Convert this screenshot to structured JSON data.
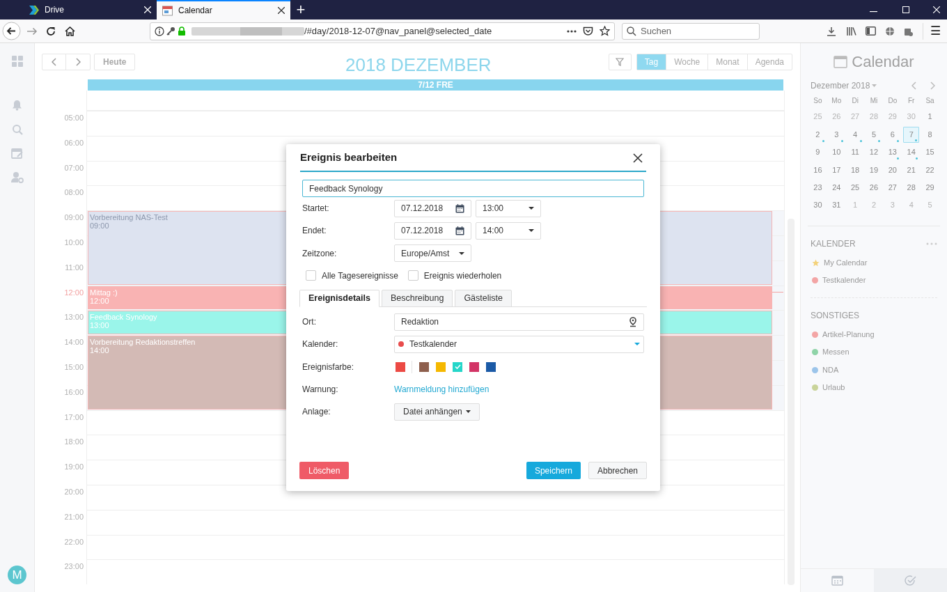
{
  "browser": {
    "tabs": [
      {
        "title": "Drive",
        "kind": "drive",
        "selected": false
      },
      {
        "title": "Calendar",
        "kind": "calendar",
        "selected": true
      }
    ],
    "new_tab": "+",
    "url": "/#day/2018-12-07@nav_panel@selected_date",
    "search": {
      "placeholder": "Suchen"
    },
    "menu": "☰"
  },
  "toolbar": {
    "today": "Heute",
    "title": "2018 DEZEMBER",
    "views": [
      {
        "label": "Tag",
        "selected": true
      },
      {
        "label": "Woche",
        "selected": false
      },
      {
        "label": "Monat",
        "selected": false
      },
      {
        "label": "Agenda",
        "selected": false
      }
    ]
  },
  "day_header": "7/12 FRE",
  "hours": [
    {
      "label": "05:00",
      "current": false,
      "busy": false
    },
    {
      "label": "06:00",
      "current": false,
      "busy": false
    },
    {
      "label": "07:00",
      "current": false,
      "busy": false
    },
    {
      "label": "08:00",
      "current": false,
      "busy": false
    },
    {
      "label": "09:00",
      "current": false,
      "busy": true
    },
    {
      "label": "10:00",
      "current": false,
      "busy": true
    },
    {
      "label": "11:00",
      "current": false,
      "busy": true
    },
    {
      "label": "12:00",
      "current": true,
      "busy": true
    },
    {
      "label": "13:00",
      "current": false,
      "busy": true
    },
    {
      "label": "14:00",
      "current": false,
      "busy": true
    },
    {
      "label": "15:00",
      "current": false,
      "busy": true
    },
    {
      "label": "16:00",
      "current": false,
      "busy": true
    },
    {
      "label": "17:00",
      "current": false
    },
    {
      "label": "18:00",
      "current": false
    },
    {
      "label": "19:00",
      "current": false
    },
    {
      "label": "20:00",
      "current": false
    },
    {
      "label": "21:00",
      "current": false
    },
    {
      "label": "22:00",
      "current": false
    },
    {
      "label": "23:00",
      "current": false
    }
  ],
  "events": [
    {
      "title": "Vorbereitung NAS-Test",
      "time": "09:00",
      "color": "#dde3f0"
    },
    {
      "title": "Mittag :)",
      "time": "12:00",
      "color": "#f9b3b3"
    },
    {
      "title": "Feedback Synology",
      "time": "13:00",
      "color": "#9af5ea"
    },
    {
      "title": "Vorbereitung Redaktionstreffen",
      "time": "14:00",
      "color": "#d3bab5"
    }
  ],
  "avatar": "M",
  "sidebar": {
    "title": "Calendar",
    "month": "Dezember 2018",
    "weekdays": [
      "So",
      "Mo",
      "Di",
      "Mi",
      "Do",
      "Fr",
      "Sa"
    ],
    "weeks": [
      [
        {
          "day": "25",
          "muted": true,
          "selected": false,
          "has_events": false
        },
        {
          "day": "26",
          "muted": true,
          "selected": false,
          "has_events": false
        },
        {
          "day": "27",
          "muted": true,
          "selected": false,
          "has_events": false
        },
        {
          "day": "28",
          "muted": true,
          "selected": false,
          "has_events": false
        },
        {
          "day": "29",
          "muted": true,
          "selected": false,
          "has_events": false
        },
        {
          "day": "30",
          "muted": true,
          "selected": false,
          "has_events": false
        },
        {
          "day": "1",
          "muted": false,
          "selected": false,
          "has_events": false
        }
      ],
      [
        {
          "day": "2",
          "muted": false,
          "selected": false,
          "has_events": true
        },
        {
          "day": "3",
          "muted": false,
          "selected": false,
          "has_events": true
        },
        {
          "day": "4",
          "muted": false,
          "selected": false,
          "has_events": true
        },
        {
          "day": "5",
          "muted": false,
          "selected": false,
          "has_events": true
        },
        {
          "day": "6",
          "muted": false,
          "selected": false,
          "has_events": true
        },
        {
          "day": "7",
          "muted": false,
          "selected": true,
          "has_events": true
        },
        {
          "day": "8",
          "muted": false,
          "selected": false,
          "has_events": false
        }
      ],
      [
        {
          "day": "9",
          "muted": false,
          "selected": false,
          "has_events": false
        },
        {
          "day": "10",
          "muted": false,
          "selected": false,
          "has_events": false
        },
        {
          "day": "11",
          "muted": false,
          "selected": false,
          "has_events": false
        },
        {
          "day": "12",
          "muted": false,
          "selected": false,
          "has_events": false
        },
        {
          "day": "13",
          "muted": false,
          "selected": false,
          "has_events": true
        },
        {
          "day": "14",
          "muted": false,
          "selected": false,
          "has_events": true
        },
        {
          "day": "15",
          "muted": false,
          "selected": false,
          "has_events": false
        }
      ],
      [
        {
          "day": "16",
          "muted": false,
          "selected": false,
          "has_events": false
        },
        {
          "day": "17",
          "muted": false,
          "selected": false,
          "has_events": false
        },
        {
          "day": "18",
          "muted": false,
          "selected": false,
          "has_events": false
        },
        {
          "day": "19",
          "muted": false,
          "selected": false,
          "has_events": false
        },
        {
          "day": "20",
          "muted": false,
          "selected": false,
          "has_events": false
        },
        {
          "day": "21",
          "muted": false,
          "selected": false,
          "has_events": false
        },
        {
          "day": "22",
          "muted": false,
          "selected": false,
          "has_events": false
        }
      ],
      [
        {
          "day": "23",
          "muted": false,
          "selected": false,
          "has_events": false
        },
        {
          "day": "24",
          "muted": false,
          "selected": false,
          "has_events": false
        },
        {
          "day": "25",
          "muted": false,
          "selected": false,
          "has_events": false
        },
        {
          "day": "26",
          "muted": false,
          "selected": false,
          "has_events": false
        },
        {
          "day": "27",
          "muted": false,
          "selected": false,
          "has_events": false
        },
        {
          "day": "28",
          "muted": false,
          "selected": false,
          "has_events": false
        },
        {
          "day": "29",
          "muted": false,
          "selected": false,
          "has_events": false
        }
      ],
      [
        {
          "day": "30",
          "muted": false,
          "selected": false,
          "has_events": false
        },
        {
          "day": "31",
          "muted": false,
          "selected": false,
          "has_events": false
        },
        {
          "day": "1",
          "muted": true,
          "selected": false,
          "has_events": false
        },
        {
          "day": "2",
          "muted": true,
          "selected": false,
          "has_events": false
        },
        {
          "day": "3",
          "muted": true,
          "selected": false,
          "has_events": false
        },
        {
          "day": "4",
          "muted": true,
          "selected": false,
          "has_events": false
        },
        {
          "day": "5",
          "muted": true,
          "selected": false,
          "has_events": false
        }
      ]
    ],
    "sections": [
      {
        "heading": "KALENDER",
        "items": [
          {
            "label": "My Calendar",
            "kind": "star",
            "color": "#f3d27a"
          },
          {
            "label": "Testkalender",
            "kind": "dot",
            "color": "#f3a5a5"
          }
        ]
      },
      {
        "heading": "SONSTIGES",
        "items": [
          {
            "label": "Artikel-Planung",
            "kind": "dot",
            "color": "#f3a5a5"
          },
          {
            "label": "Messen",
            "kind": "dot",
            "color": "#8fd4a8"
          },
          {
            "label": "NDA",
            "kind": "dot",
            "color": "#9cc5ea"
          },
          {
            "label": "Urlaub",
            "kind": "dot",
            "color": "#c9d49a"
          }
        ]
      }
    ]
  },
  "dialog": {
    "title": "Ereignis bearbeiten",
    "name": "Feedback Synology",
    "start": {
      "label": "Startet:",
      "date": "07.12.2018",
      "time": "13:00"
    },
    "end": {
      "label": "Endet:",
      "date": "07.12.2018",
      "time": "14:00"
    },
    "timezone": {
      "label": "Zeitzone:",
      "value": "Europe/Amst"
    },
    "checkboxes": [
      {
        "label": "Alle Tagesereignisse",
        "checked": false
      },
      {
        "label": "Ereignis wiederholen",
        "checked": false
      }
    ],
    "tabs": [
      {
        "label": "Ereignisdetails",
        "selected": true
      },
      {
        "label": "Beschreibung",
        "selected": false
      },
      {
        "label": "Gästeliste",
        "selected": false
      }
    ],
    "location": {
      "label": "Ort:",
      "value": "Redaktion"
    },
    "calendar": {
      "label": "Kalender:",
      "value": "Testkalender",
      "color": "#e84c4c"
    },
    "event_color": {
      "label": "Ereignisfarbe:",
      "swatches": [
        {
          "color": "#ec4a44",
          "kind": "default",
          "selected": false
        },
        {
          "color": "#8e5f4d",
          "kind": "custom",
          "selected": false
        },
        {
          "color": "#f5b800",
          "kind": "custom",
          "selected": false
        },
        {
          "color": "#25d6c9",
          "kind": "custom",
          "selected": true
        },
        {
          "color": "#d23466",
          "kind": "custom",
          "selected": false
        },
        {
          "color": "#1b5aa6",
          "kind": "custom",
          "selected": false
        }
      ]
    },
    "warning": {
      "label": "Warnung:",
      "link": "Warnmeldung hinzufügen"
    },
    "attachment": {
      "label": "Anlage:",
      "button": "Datei anhängen"
    },
    "buttons": {
      "delete": "Löschen",
      "save": "Speichern",
      "cancel": "Abbrechen"
    }
  }
}
